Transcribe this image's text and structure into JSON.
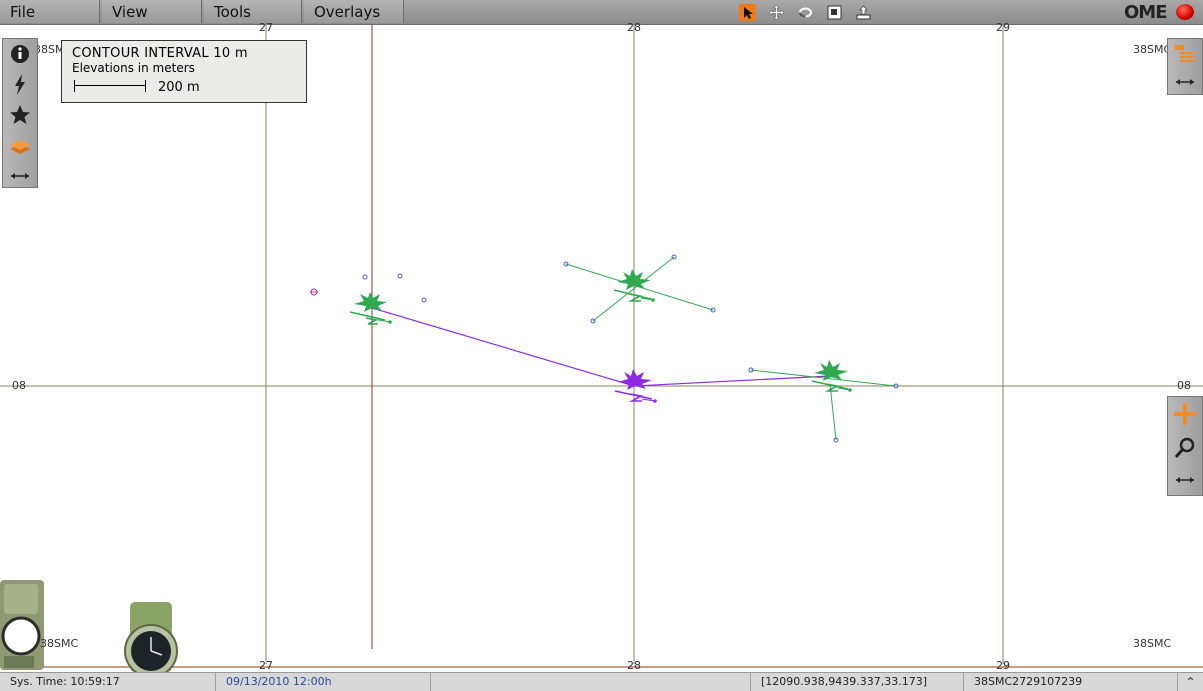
{
  "menu": {
    "file": "File",
    "view": "View",
    "tools": "Tools",
    "overlays": "Overlays"
  },
  "toolbar": {
    "icons": [
      "pointer-icon",
      "pan-icon",
      "rotate-icon",
      "fit-icon",
      "export-icon"
    ],
    "logo": "OME"
  },
  "legend": {
    "line1": "CONTOUR INTERVAL 10 m",
    "line2": "Elevations in meters",
    "scale": "200 m"
  },
  "grid": {
    "zone_label": "38SMC",
    "easting_top": [
      "27",
      "28",
      "29"
    ],
    "easting_bottom": [
      "27",
      "28",
      "29"
    ],
    "northing": "08"
  },
  "left_panel": {
    "icons": [
      "info-icon",
      "lightning-icon",
      "star-icon",
      "layers-icon",
      "resize-icon"
    ]
  },
  "right_top_panel": {
    "icons": [
      "layer-list-icon",
      "resize-icon"
    ]
  },
  "right_zoom_panel": {
    "icons": [
      "zoom-in-icon",
      "zoom-search-icon",
      "resize-icon"
    ]
  },
  "units": {
    "colors": {
      "friendly": "#2fa84f",
      "selected": "#8b2be2",
      "waypoint": "#4a5bd8"
    }
  },
  "status": {
    "sys_time": "Sys. Time: 10:59:17",
    "date": "09/13/2010  12:00h",
    "coords": "[12090.938,9439.337,33.173]",
    "mgrs": "38SMC2729107239"
  }
}
